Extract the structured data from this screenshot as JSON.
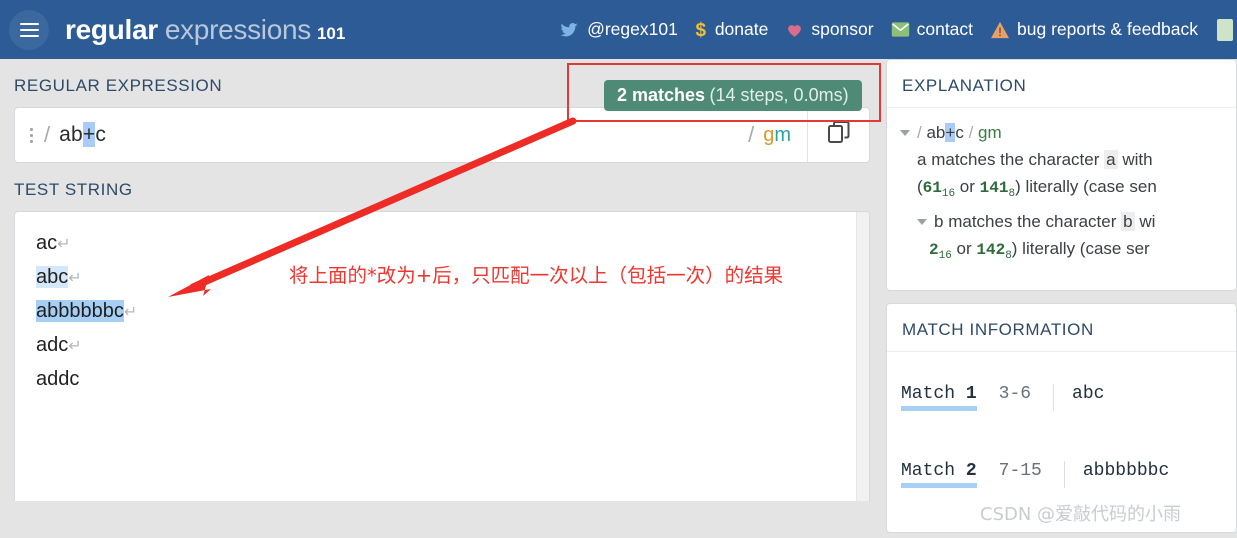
{
  "header": {
    "menu_icon": "hamburger-icon",
    "brand": {
      "word1": "regular",
      "word2": "expressions",
      "suffix": "101"
    },
    "nav": [
      {
        "icon": "twitter-icon",
        "label": "@regex101"
      },
      {
        "icon": "dollar-icon",
        "label": "donate"
      },
      {
        "icon": "heart-icon",
        "label": "sponsor"
      },
      {
        "icon": "envelope-icon",
        "label": "contact"
      },
      {
        "icon": "warning-icon",
        "label": "bug reports & feedback"
      }
    ]
  },
  "regex_section": {
    "label": "REGULAR EXPRESSION",
    "match_badge": {
      "count_text": "2 matches",
      "detail_text": "(14 steps, 0.0ms)"
    },
    "kebab_icon": "kebab-menu-icon",
    "delimiter": "/",
    "pattern_before": "ab",
    "pattern_highlight": "+",
    "pattern_after": "c",
    "flag_g": "g",
    "flag_m": "m",
    "copy_icon": "copy-icon"
  },
  "test_string_section": {
    "label": "TEST STRING",
    "lines": [
      {
        "text": "ac",
        "match": "none",
        "newline": "↵"
      },
      {
        "text": "abc",
        "match": "light",
        "newline": "↵"
      },
      {
        "text": "abbbbbbc",
        "match": "full",
        "newline": "↵"
      },
      {
        "text": "adc",
        "match": "none",
        "newline": "↵"
      },
      {
        "text": "addc",
        "match": "none",
        "newline": ""
      }
    ]
  },
  "explanation": {
    "title": "EXPLANATION",
    "header_row": {
      "delim": "/",
      "before": "ab",
      "highlight": "+",
      "after": "c",
      "flags": "gm"
    },
    "rows": [
      {
        "char": "a",
        "text_start": "matches the character",
        "chip": "a",
        "text_end": "with",
        "hex": "61",
        "hex_base": "16",
        "oct": "141",
        "oct_base": "8",
        "literal": ") literally (case sen"
      },
      {
        "char": "b",
        "text_start": "matches the character",
        "chip": "b",
        "text_end": "wi",
        "hex": "2",
        "hex_base": "16",
        "oct": "142",
        "oct_base": "8",
        "literal": ") literally (case ser"
      }
    ]
  },
  "match_information": {
    "title": "MATCH INFORMATION",
    "matches": [
      {
        "label": "Match",
        "index": "1",
        "range": "3-6",
        "value": "abc"
      },
      {
        "label": "Match",
        "index": "2",
        "range": "7-15",
        "value": "abbbbbbc"
      }
    ]
  },
  "annotations": {
    "note_text": "将上面的*改为+后，只匹配一次以上（包括一次）的结果",
    "note_color": "#f0352f",
    "arrow_color": "#ee2b24",
    "highlight_box_color": "#e03a33",
    "watermark": "CSDN @爱敲代码的小雨"
  }
}
